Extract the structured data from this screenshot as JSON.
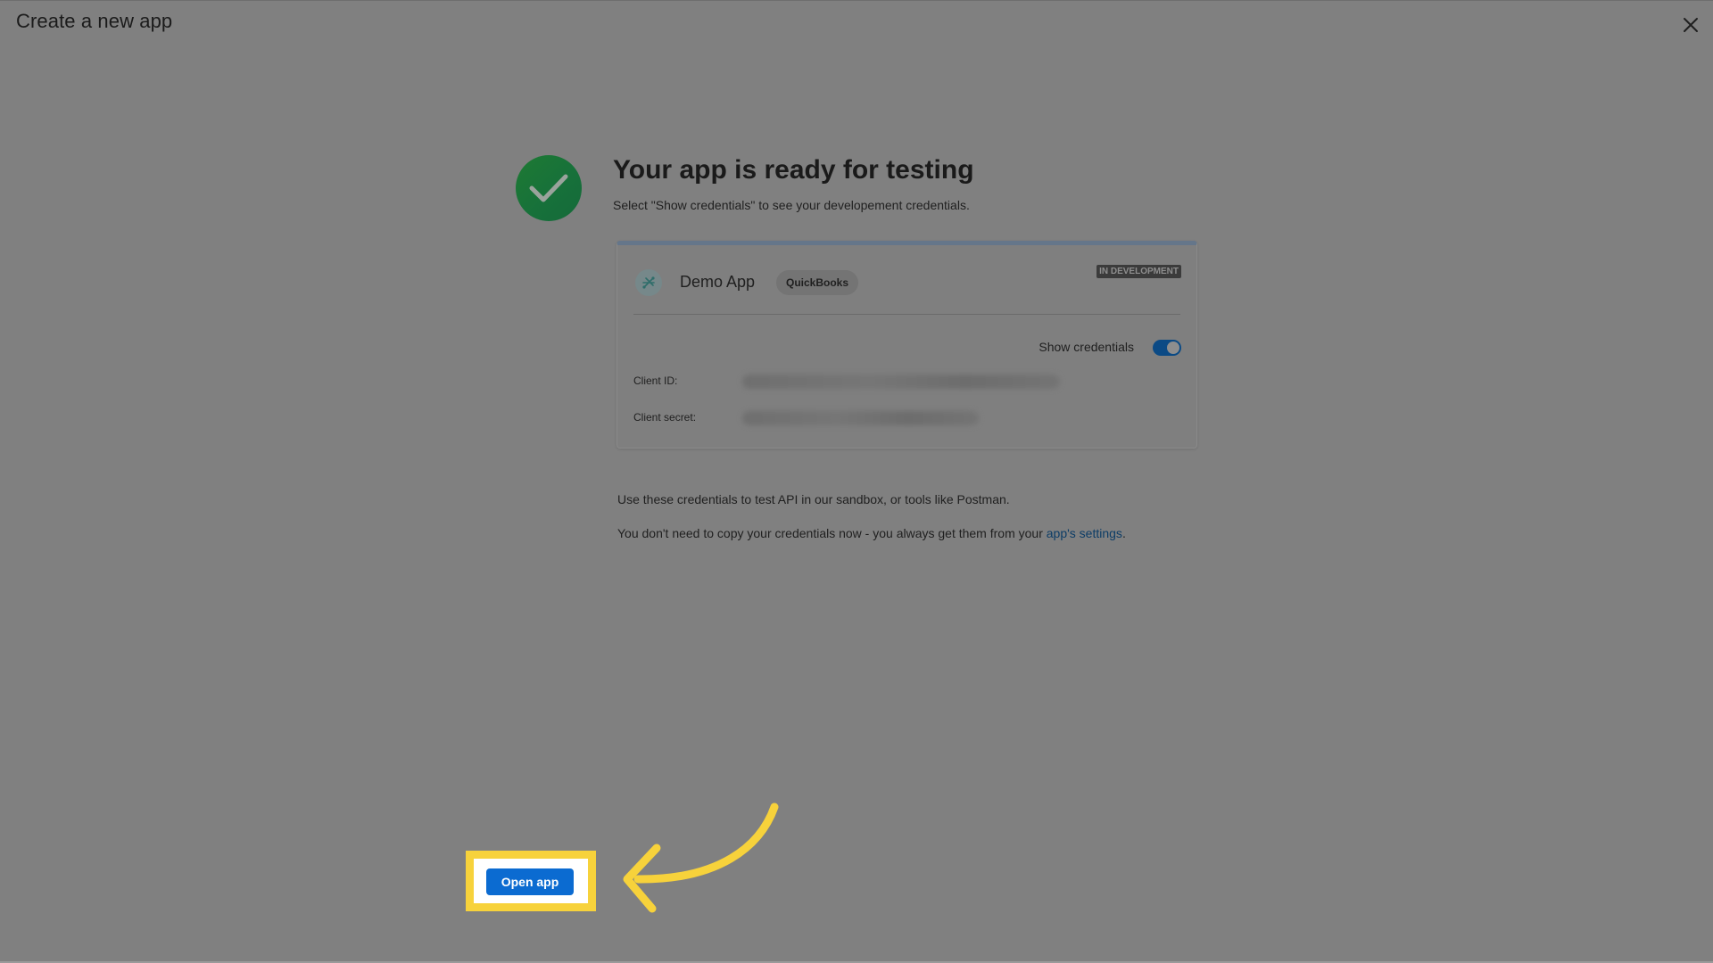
{
  "header": {
    "title": "Create a new app",
    "close_icon": "close-icon"
  },
  "success": {
    "icon": "checkmark-circle-icon",
    "headline": "Your app is ready for testing",
    "subtext": "Select \"Show credentials\" to see your developement credentials."
  },
  "app_card": {
    "app_icon": "app-logo-icon",
    "name": "Demo App",
    "platform_chip": "QuickBooks",
    "status_badge": "IN DEVELOPMENT",
    "show_credentials_label": "Show credentials",
    "show_credentials_on": true,
    "client_id_label": "Client ID:",
    "client_secret_label": "Client secret:"
  },
  "info": {
    "line1": "Use these credentials to test API in our sandbox, or tools like Postman.",
    "line2_prefix": "You don't need to copy your credentials now - you always get them from your ",
    "line2_link": "app's settings",
    "line2_suffix": "."
  },
  "actions": {
    "open_app_label": "Open app"
  },
  "annotation": {
    "highlight_color": "#f7d23b",
    "arrow_icon": "curved-arrow-icon"
  },
  "colors": {
    "overlay": "#808080",
    "primary_button": "#0b6bd1",
    "success_green": "#1e7a33",
    "toggle_on": "#0b4a85"
  }
}
